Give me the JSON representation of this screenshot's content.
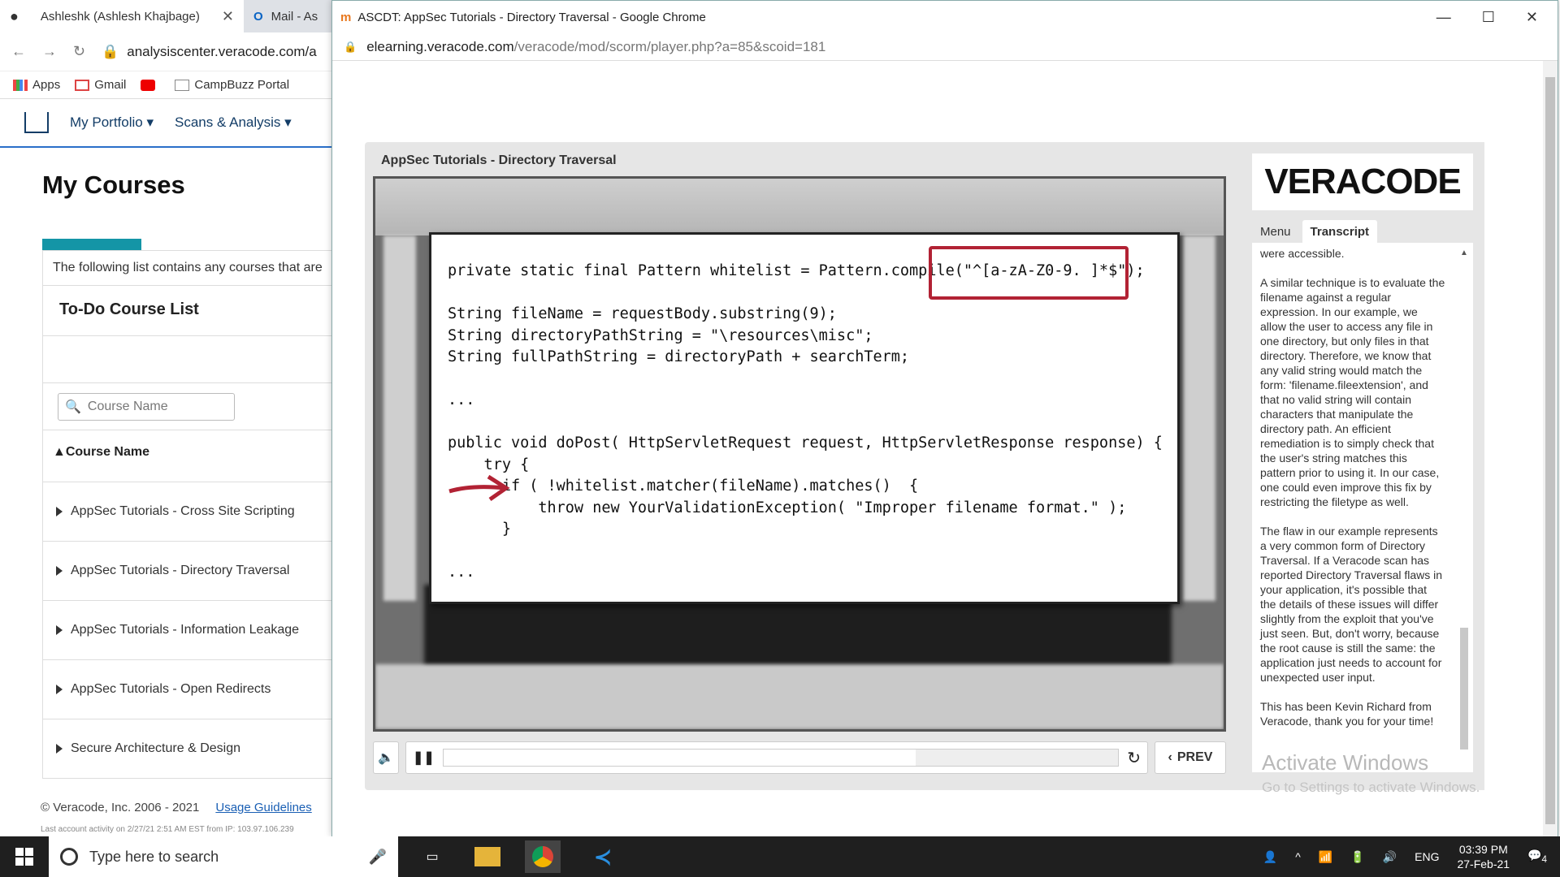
{
  "bg_browser": {
    "tabs": [
      {
        "label": "Ashleshk (Ashlesh Khajbage)",
        "active": true
      },
      {
        "label": "Mail - As",
        "active": false
      }
    ],
    "url": "analysiscenter.veracode.com/a",
    "bookmarks": [
      "Apps",
      "Gmail",
      "",
      "CampBuzz Portal"
    ],
    "nav": [
      "My Portfolio",
      "Scans & Analysis"
    ],
    "page_title": "My Courses",
    "intro": "The following list contains any courses that are",
    "todo_title": "To-Do Course List",
    "search_placeholder": "Course Name",
    "sort_header": "Course Name",
    "courses": [
      "AppSec Tutorials - Cross Site Scripting",
      "AppSec Tutorials - Directory Traversal",
      "AppSec Tutorials - Information Leakage",
      "AppSec Tutorials - Open Redirects",
      "Secure Architecture & Design"
    ],
    "footer_copy": "© Veracode, Inc. 2006 - 2021",
    "footer_link": "Usage Guidelines",
    "activity": "Last account activity on 2/27/21 2:51 AM EST from IP: 103.97.106.239"
  },
  "popup": {
    "window_title": "ASCDT: AppSec Tutorials - Directory Traversal - Google Chrome",
    "url_host": "elearning.veracode.com",
    "url_path": "/veracode/mod/scorm/player.php?a=85&scoid=181",
    "player_title": "AppSec Tutorials - Directory Traversal",
    "code_lines": [
      "private static final Pattern whitelist = Pattern.compile(\"^[a-zA-Z0-9. ]*$\");",
      "",
      "String fileName = requestBody.substring(9);",
      "String directoryPathString = \"\\resources\\misc\";",
      "String fullPathString = directoryPath + searchTerm;",
      "",
      "...",
      "",
      "public void doPost( HttpServletRequest request, HttpServletResponse response) {",
      "    try {",
      "      if ( !whitelist.matcher(fileName).matches()  {",
      "          throw new YourValidationException( \"Improper filename format.\" );",
      "      }",
      "",
      "..."
    ],
    "controls": {
      "prev_label": "PREV",
      "progress": 0.7
    },
    "logo": "VERACODE",
    "sidebar_tabs": [
      "Menu",
      "Transcript"
    ],
    "transcript": [
      "were accessible.",
      "A similar technique is to evaluate the filename against a regular expression. In our example, we allow the user to access any file in one directory, but only files in that directory. Therefore, we know that any valid string would match the form: 'filename.fileextension', and that no valid string will contain characters that manipulate the directory path. An efficient remediation is to simply check that the user's string matches this pattern prior to using it. In our case, one could even improve this fix by restricting the filetype as well.",
      "The flaw in our example represents a very common form of Directory Traversal. If a Veracode scan has reported Directory Traversal flaws in your application, it's possible that the details of these issues will differ slightly from the exploit that you've just seen. But, don't worry, because the root cause is still the same: the application just needs to account for unexpected user input.",
      "This has been Kevin Richard from Veracode, thank you for your time!"
    ]
  },
  "watermark": {
    "title": "Activate Windows",
    "subtitle": "Go to Settings to activate Windows."
  },
  "taskbar": {
    "search_placeholder": "Type here to search",
    "lang": "ENG",
    "time": "03:39 PM",
    "date": "27-Feb-21",
    "notifications": "4"
  }
}
